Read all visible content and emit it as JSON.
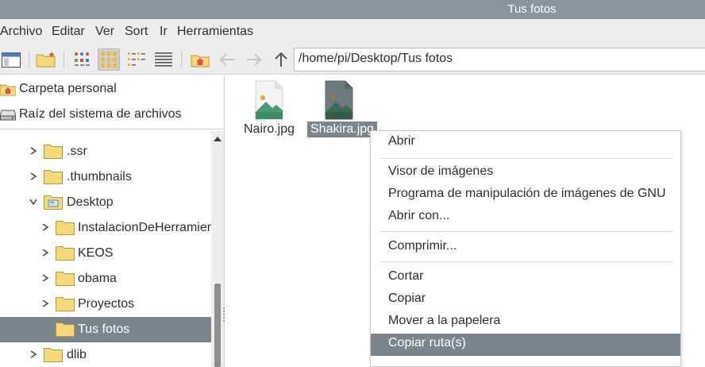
{
  "window": {
    "title": "Tus fotos"
  },
  "menubar": {
    "items": [
      "Archivo",
      "Editar",
      "Ver",
      "Sort",
      "Ir",
      "Herramientas"
    ]
  },
  "toolbar": {
    "buttons": [
      "new-window-icon",
      "new-folder-icon",
      "icon-view-icon",
      "thumbnail-view-icon",
      "compact-view-icon",
      "list-view-icon",
      "home-icon",
      "back-arrow-icon",
      "forward-arrow-icon",
      "up-arrow-icon"
    ],
    "active_view": "thumbnail-view-icon",
    "path": "/home/pi/Desktop/Tus fotos"
  },
  "sidebar": {
    "places": [
      {
        "label": "Carpeta personal",
        "icon": "home-icon"
      },
      {
        "label": "Raíz del sistema de archivos",
        "icon": "drive-icon"
      }
    ],
    "tree": [
      {
        "label": ".ssr",
        "expander": "collapsed",
        "selected": false
      },
      {
        "label": ".thumbnails",
        "expander": "collapsed",
        "selected": false
      },
      {
        "label": "Desktop",
        "expander": "expanded",
        "selected": false
      },
      {
        "label": "InstalacionDeHerramientas",
        "expander": "collapsed",
        "selected": false
      },
      {
        "label": "KEOS",
        "expander": "collapsed",
        "selected": false
      },
      {
        "label": "obama",
        "expander": "collapsed",
        "selected": false
      },
      {
        "label": "Proyectos",
        "expander": "collapsed",
        "selected": false
      },
      {
        "label": "Tus fotos",
        "expander": "none",
        "selected": true
      },
      {
        "label": "dlib",
        "expander": "collapsed",
        "selected": false
      }
    ]
  },
  "files": [
    {
      "name": "Nairo.jpg",
      "icon": "image-file-icon",
      "selected": false
    },
    {
      "name": "Shakira.jpg",
      "icon": "image-file-icon",
      "selected": true
    }
  ],
  "context_menu": {
    "groups": [
      [
        "Abrir"
      ],
      [
        "Visor de imágenes",
        "Programa de manipulación de imágenes de GNU",
        "Abrir con..."
      ],
      [
        "Comprimir..."
      ],
      [
        "Cortar",
        "Copiar",
        "Mover a la papelera",
        "Copiar ruta(s)"
      ]
    ],
    "highlighted": "Copiar ruta(s)"
  },
  "colors": {
    "titlebar": "#8b949c",
    "selection": "#7b858d",
    "folder": "#f5d77c",
    "chrome": "#ededed",
    "home_accent": "#d9534f"
  }
}
